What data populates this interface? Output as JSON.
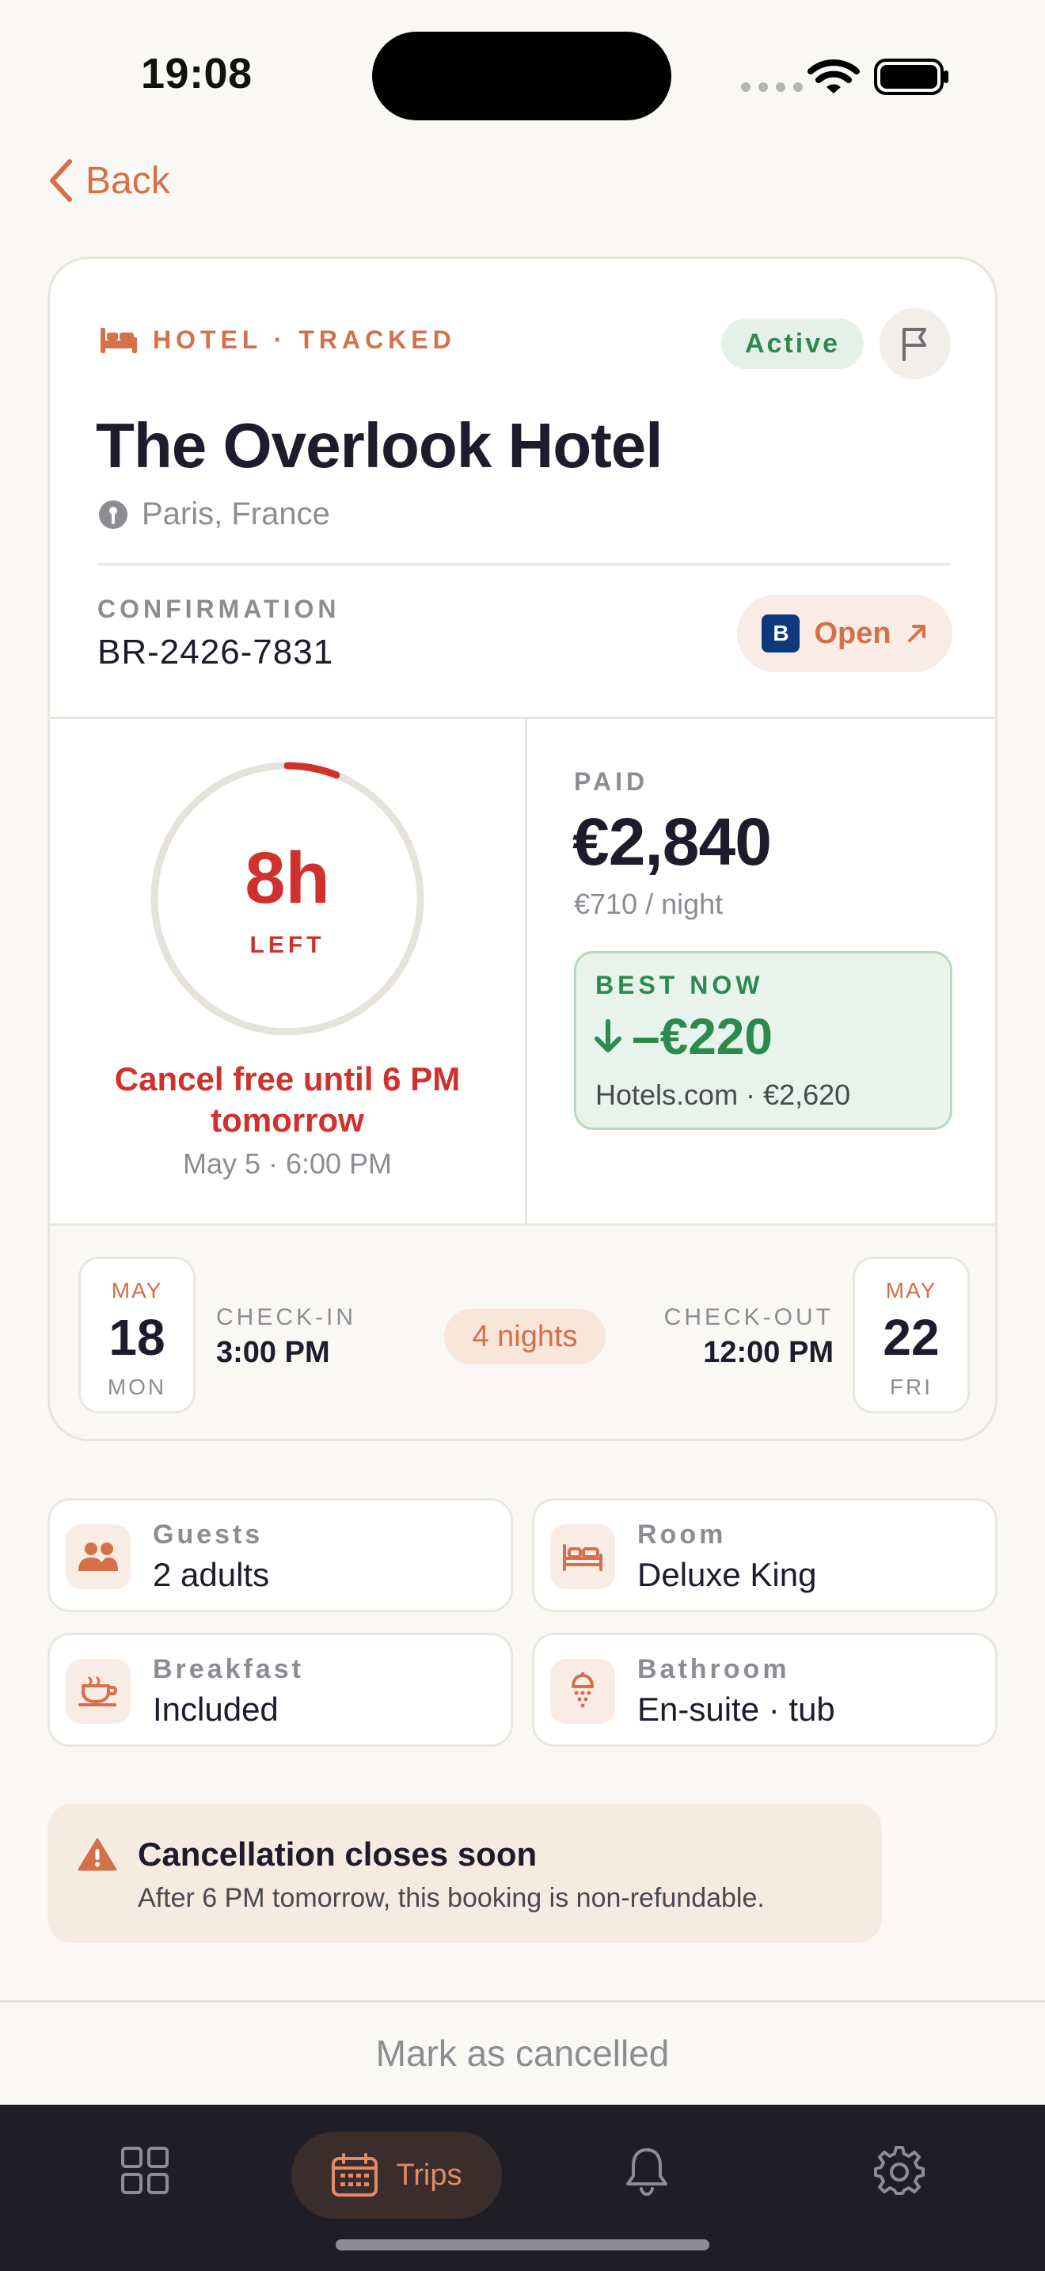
{
  "status_bar": {
    "time": "19:08"
  },
  "nav": {
    "back_label": "Back"
  },
  "booking": {
    "eyebrow": "HOTEL · TRACKED",
    "status": "Active",
    "hotel_name": "The Overlook Hotel",
    "location": "Paris, France",
    "confirmation_label": "CONFIRMATION",
    "confirmation_number": "BR-2426-7831",
    "open_button": {
      "provider_letter": "B",
      "label": "Open"
    },
    "countdown": {
      "value": "8h",
      "unit": "LEFT",
      "ring_fraction": 0.06,
      "cancel_free": "Cancel free until 6 PM tomorrow",
      "deadline": "May 5 · 6:00 PM"
    },
    "price": {
      "paid_label": "PAID",
      "paid_amount": "€2,840",
      "per_night": "€710 / night",
      "best_label": "BEST NOW",
      "best_saving": "–€220",
      "best_source": "Hotels.com · €2,620"
    },
    "dates": {
      "check_in": {
        "month": "MAY",
        "day": "18",
        "weekday": "MON",
        "label": "CHECK-IN",
        "time": "3:00 PM"
      },
      "nights": "4 nights",
      "check_out": {
        "month": "MAY",
        "day": "22",
        "weekday": "FRI",
        "label": "CHECK-OUT",
        "time": "12:00 PM"
      }
    }
  },
  "details": [
    {
      "label": "Guests",
      "value": "2 adults",
      "icon": "people-icon"
    },
    {
      "label": "Room",
      "value": "Deluxe King",
      "icon": "bed-icon"
    },
    {
      "label": "Breakfast",
      "value": "Included",
      "icon": "cup-icon"
    },
    {
      "label": "Bathroom",
      "value": "En-suite · tub",
      "icon": "shower-icon"
    }
  ],
  "warning": {
    "title": "Cancellation closes soon",
    "text": "After 6 PM tomorrow, this booking is non-refundable."
  },
  "mark_cancelled": "Mark as cancelled",
  "tabbar": {
    "active_label": "Trips"
  },
  "colors": {
    "accent": "#D4704A",
    "danger": "#D0312D",
    "success": "#2D8A4E",
    "background": "#FAF8F4",
    "tabbar": "#1F1E26"
  }
}
